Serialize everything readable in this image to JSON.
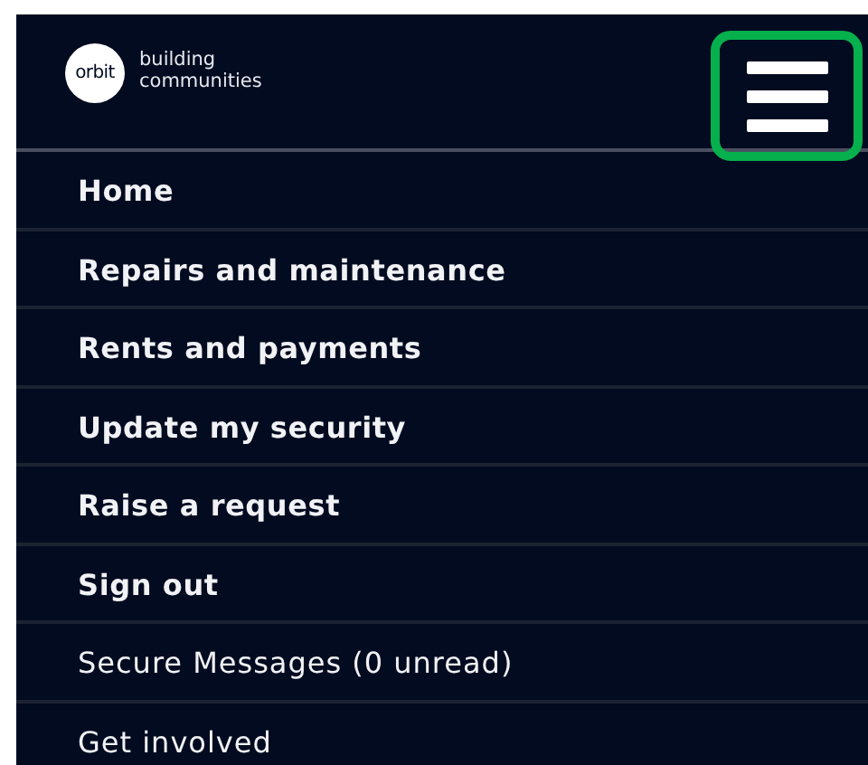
{
  "header": {
    "logo": {
      "mark": "orbit",
      "tagline_lines": [
        "building",
        "communities"
      ]
    },
    "menu_button": {
      "highlighted": true
    }
  },
  "menu": [
    {
      "label": "Home",
      "kind": "primary"
    },
    {
      "label": "Repairs and maintenance",
      "kind": "primary"
    },
    {
      "label": "Rents and payments",
      "kind": "primary"
    },
    {
      "label": "Update my security",
      "kind": "primary"
    },
    {
      "label": "Raise a request",
      "kind": "primary"
    },
    {
      "label": "Sign out",
      "kind": "primary"
    },
    {
      "label": "Secure Messages (0 unread)",
      "kind": "secondary"
    },
    {
      "label": "Get involved",
      "kind": "secondary"
    }
  ]
}
